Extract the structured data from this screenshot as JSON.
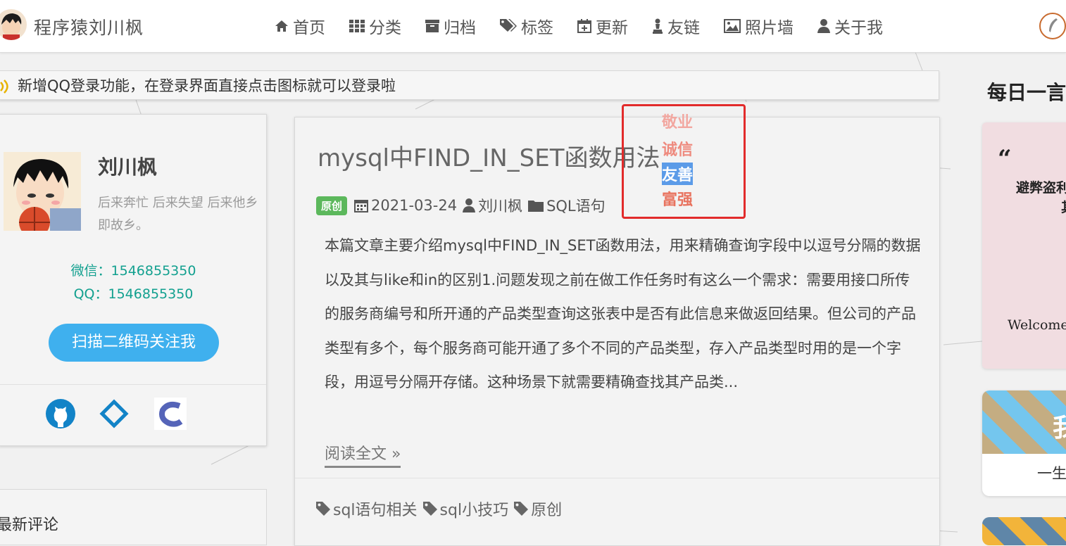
{
  "header": {
    "site_title": "程序猿刘川枫",
    "nav": [
      {
        "label": "首页",
        "icon": "home-icon"
      },
      {
        "label": "分类",
        "icon": "grid-icon"
      },
      {
        "label": "归档",
        "icon": "archive-icon"
      },
      {
        "label": "标签",
        "icon": "tags-icon"
      },
      {
        "label": "更新",
        "icon": "calendar-plus-icon"
      },
      {
        "label": "友链",
        "icon": "chess-pawn-icon"
      },
      {
        "label": "照片墙",
        "icon": "image-icon"
      },
      {
        "label": "关于我",
        "icon": "user-icon"
      }
    ]
  },
  "notice": {
    "text": "新增QQ登录功能，在登录界面直接点击图标就可以登录啦"
  },
  "profile": {
    "name": "刘川枫",
    "motto": "后来奔忙 后来失望 后来他乡即故乡。",
    "wechat": "微信：1546855350",
    "qq": "QQ：1546855350",
    "follow_button": "扫描二维码关注我",
    "social_icons": [
      "github-icon",
      "gitee-icon",
      "csdn-icon"
    ]
  },
  "comments": {
    "title": "最新评论"
  },
  "article": {
    "title": "mysql中FIND_IN_SET函数用法",
    "badge": "原创",
    "date": "2021-03-24",
    "author": "刘川枫",
    "category": "SQL语句",
    "excerpt": "本篇文章主要介绍mysql中FIND_IN_SET函数用法，用来精确查询字段中以逗号分隔的数据以及其与like和in的区别1.问题发现之前在做工作任务时有这么一个需求：需要用接口所传的服务商编号和所开通的产品类型查询这张表中是否有此信息来做返回结果。但公司的产品类型有多个，每个服务商可能开通了多个不同的产品类型，存入产品类型时用的是一个字段，用逗号分隔开存储。这种场景下就需要精确查找其产品类...",
    "read_more": "阅读全文 »",
    "tags": [
      "sql语句相关",
      "sql小技巧",
      "原创"
    ]
  },
  "floating_words": [
    {
      "text": "敬业",
      "color": "#f2a7a0"
    },
    {
      "text": "诚信",
      "color": "#ee8a7e"
    },
    {
      "text": "友善",
      "color": "#ffffff",
      "highlight": "#5b9be8"
    },
    {
      "text": "富强",
      "color": "#e8735f"
    }
  ],
  "sidebar": {
    "daily_title": "每日一言",
    "quote_line1": "避弊盗利",
    "quote_line2": "其",
    "quote_welcome": "Welcome",
    "card2_letter": "我",
    "card2_text": "一生"
  },
  "colors": {
    "accent_teal": "#12a08f",
    "button_blue": "#3fb0ee",
    "badge_green": "#5cb85c",
    "highlight_red": "#e22b2b"
  }
}
